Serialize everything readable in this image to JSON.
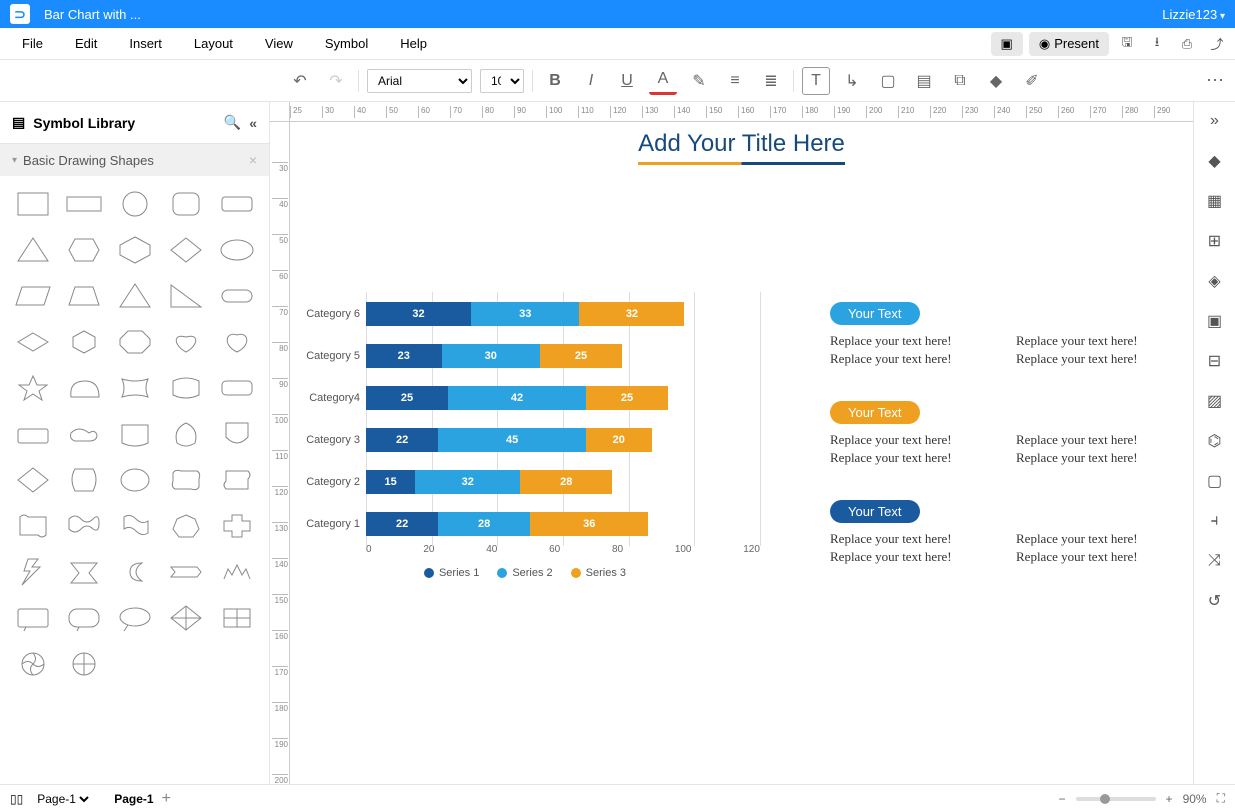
{
  "header": {
    "doc_title": "Bar Chart with ...",
    "user": "Lizzie123"
  },
  "menu": [
    "File",
    "Edit",
    "Insert",
    "Layout",
    "View",
    "Symbol",
    "Help"
  ],
  "menu_right": {
    "present": "Present"
  },
  "toolbar": {
    "font": "Arial",
    "font_size": "10"
  },
  "sidebar": {
    "title": "Symbol Library",
    "category": "Basic Drawing Shapes"
  },
  "ruler_h": [
    25,
    30,
    40,
    50,
    60,
    70,
    80,
    90,
    100,
    110,
    120,
    130,
    140,
    150,
    160,
    170,
    180,
    190,
    200,
    210,
    220,
    230,
    240,
    250,
    260,
    270,
    280,
    290
  ],
  "ruler_v": [
    30,
    40,
    50,
    60,
    70,
    80,
    90,
    100,
    110,
    120,
    130,
    140,
    150,
    160,
    170,
    180,
    190,
    200
  ],
  "canvas": {
    "title": "Add Your Title Here"
  },
  "chart_data": {
    "type": "bar",
    "orientation": "horizontal",
    "stacked": true,
    "categories": [
      "Category 1",
      "Category 2",
      "Category 3",
      "Category4",
      "Category 5",
      "Category 6"
    ],
    "series": [
      {
        "name": "Series 1",
        "color": "#1a5a9e",
        "values": [
          22,
          15,
          22,
          25,
          23,
          32
        ]
      },
      {
        "name": "Series 2",
        "color": "#2aa3e0",
        "values": [
          28,
          32,
          45,
          42,
          30,
          33
        ]
      },
      {
        "name": "Series 3",
        "color": "#f0a020",
        "values": [
          36,
          28,
          20,
          25,
          25,
          32
        ]
      }
    ],
    "x_ticks": [
      0,
      20,
      40,
      60,
      80,
      100,
      120
    ],
    "xlim": [
      0,
      120
    ]
  },
  "text_blocks": [
    {
      "pill": "Your Text",
      "lines": [
        "Replace your text here!",
        "Replace your text here!",
        "Replace your text here!",
        "Replace your text here!"
      ]
    },
    {
      "pill": "Your Text",
      "lines": [
        "Replace your text here!",
        "Replace your text here!",
        "Replace your text here!",
        "Replace your text here!"
      ]
    },
    {
      "pill": "Your Text",
      "lines": [
        "Replace your text here!",
        "Replace your text here!",
        "Replace your text here!",
        "Replace your text here!"
      ]
    }
  ],
  "status": {
    "page_select": "Page-1",
    "tab": "Page-1",
    "zoom": "90%"
  }
}
